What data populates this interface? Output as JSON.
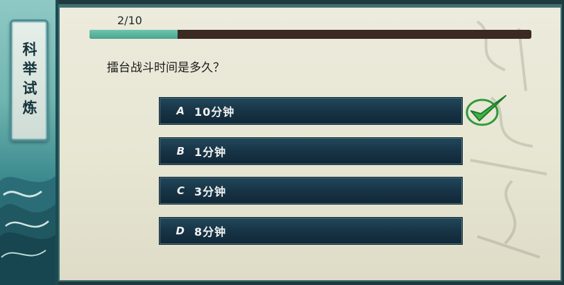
{
  "sidebar": {
    "title": "科举试炼"
  },
  "progress": {
    "label": "2/10",
    "current": 2,
    "total": 10,
    "fraction": 0.2
  },
  "question": {
    "text": "擂台战斗时间是多久？"
  },
  "options": [
    {
      "letter": "A",
      "text": "10分钟",
      "correct": true
    },
    {
      "letter": "B",
      "text": "1分钟",
      "correct": false
    },
    {
      "letter": "C",
      "text": "3分钟",
      "correct": false
    },
    {
      "letter": "D",
      "text": "8分钟",
      "correct": false
    }
  ],
  "icons": {
    "correct_mark": "checkmark-icon"
  },
  "colors": {
    "progress_fill": "#4aa58e",
    "progress_track": "#3a2a22",
    "option_bg": "#173446",
    "check_green": "#2f9a3a"
  }
}
